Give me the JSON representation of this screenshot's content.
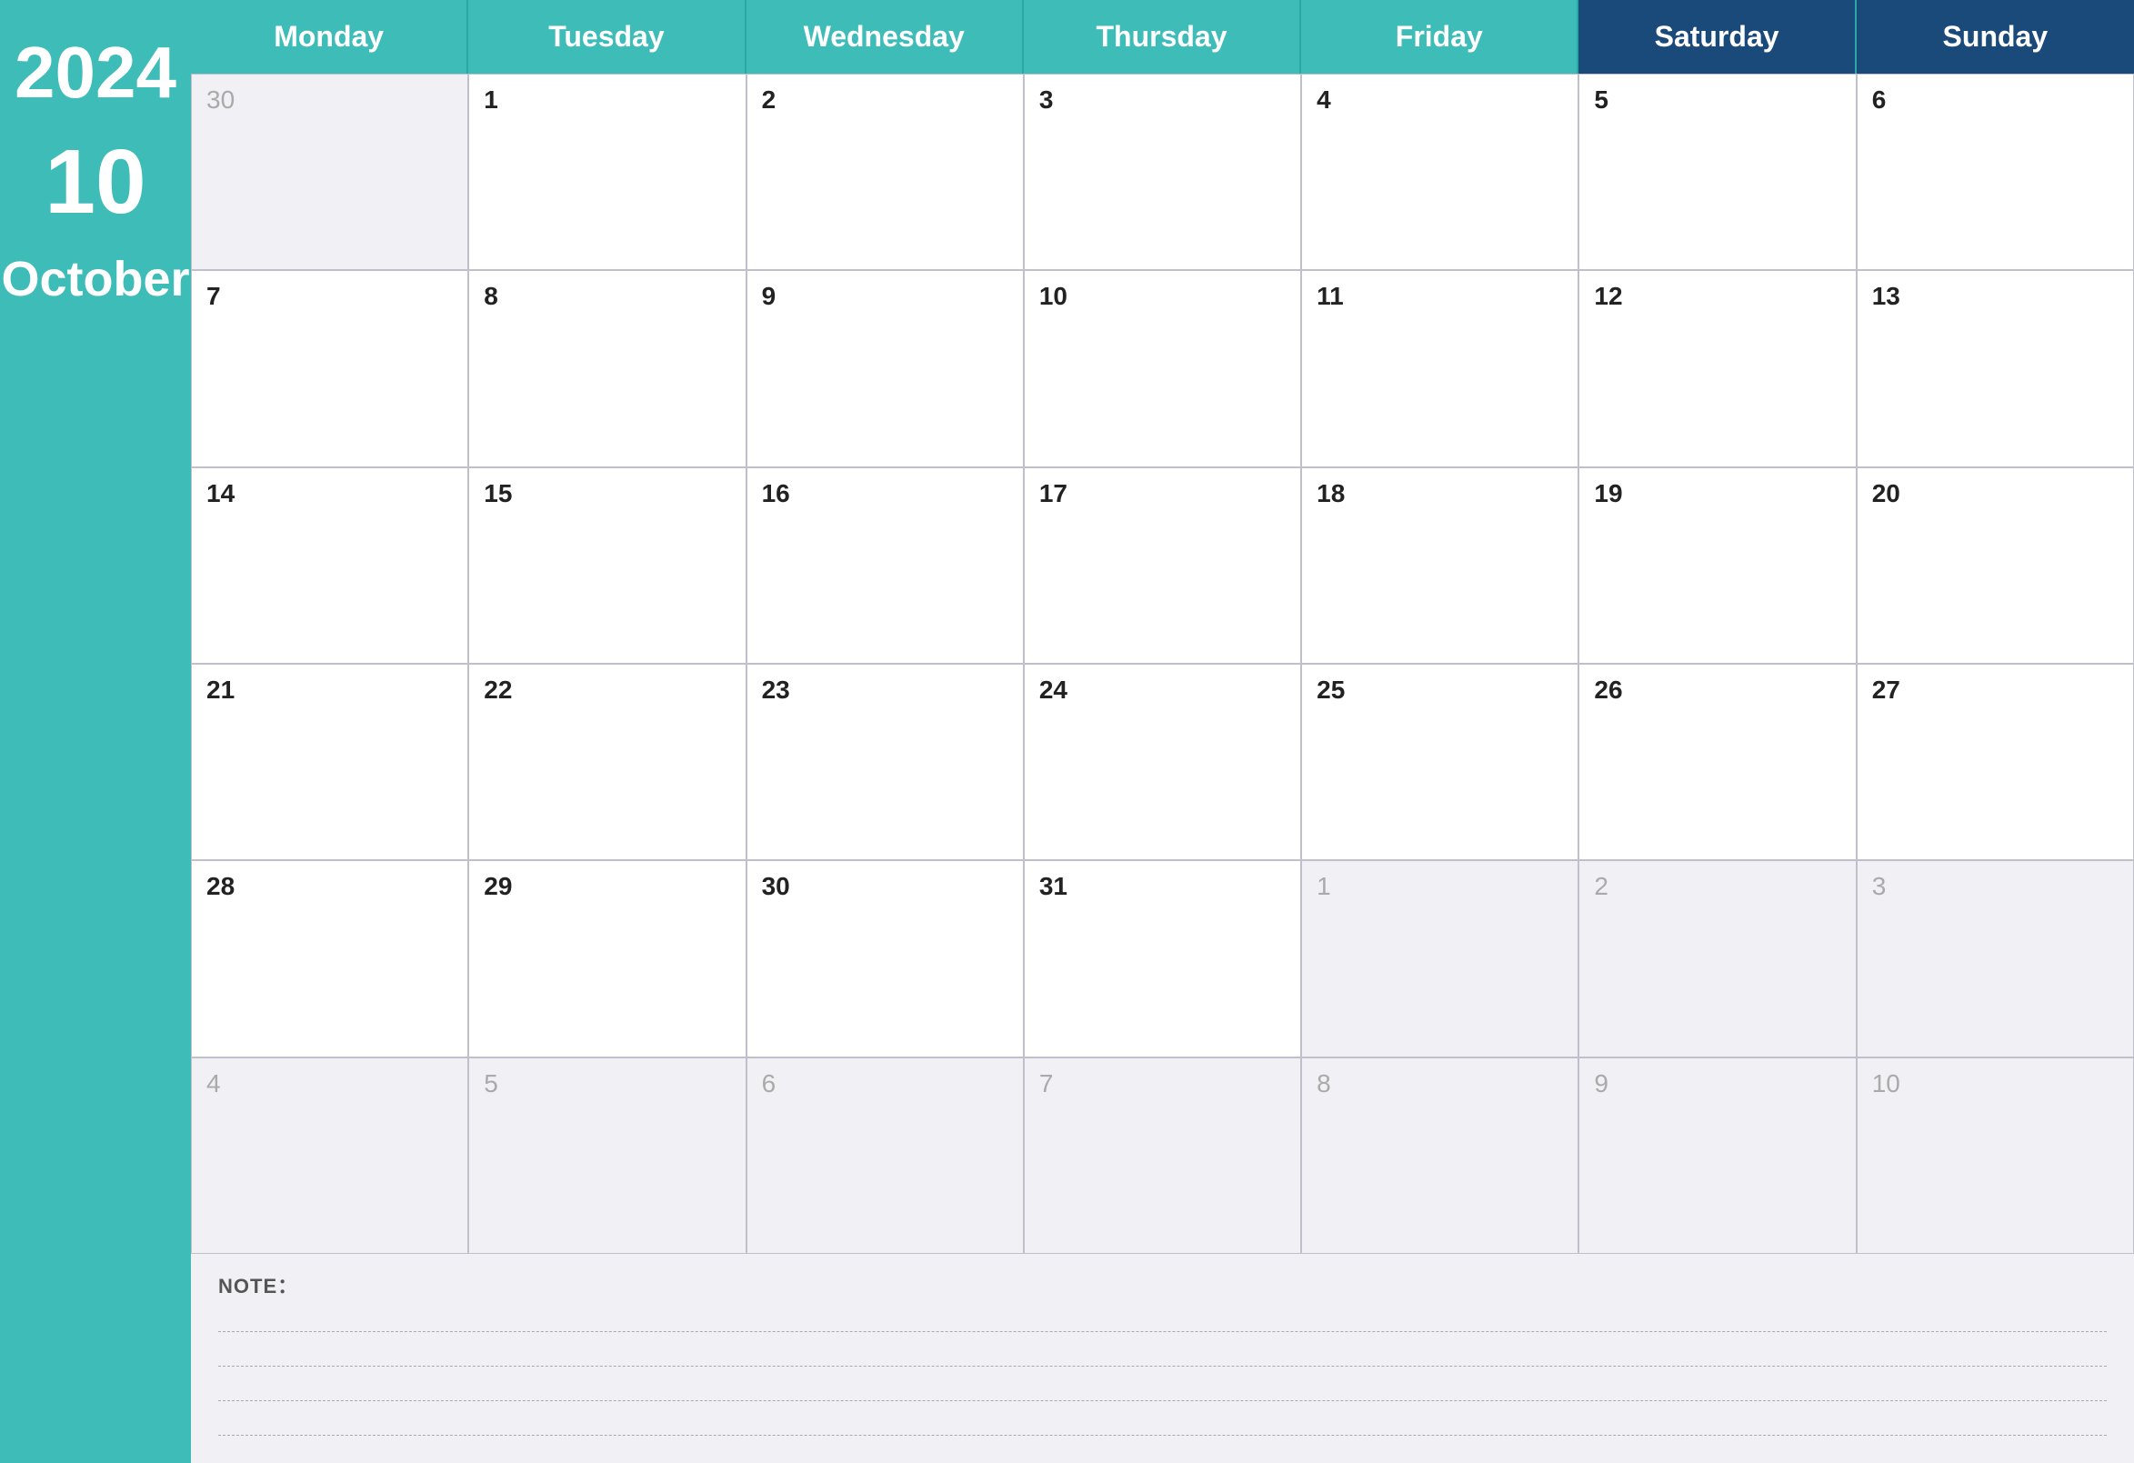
{
  "sidebar": {
    "year": "2024",
    "month_num": "10",
    "month_name": "October"
  },
  "header": {
    "days": [
      {
        "label": "Monday",
        "type": "weekday"
      },
      {
        "label": "Tuesday",
        "type": "weekday"
      },
      {
        "label": "Wednesday",
        "type": "weekday"
      },
      {
        "label": "Thursday",
        "type": "weekday"
      },
      {
        "label": "Friday",
        "type": "weekday"
      },
      {
        "label": "Saturday",
        "type": "weekend"
      },
      {
        "label": "Sunday",
        "type": "weekend"
      }
    ]
  },
  "weeks": [
    [
      {
        "day": "30",
        "outside": true
      },
      {
        "day": "1",
        "outside": false
      },
      {
        "day": "2",
        "outside": false
      },
      {
        "day": "3",
        "outside": false
      },
      {
        "day": "4",
        "outside": false
      },
      {
        "day": "5",
        "outside": false
      },
      {
        "day": "6",
        "outside": false
      }
    ],
    [
      {
        "day": "7",
        "outside": false
      },
      {
        "day": "8",
        "outside": false
      },
      {
        "day": "9",
        "outside": false
      },
      {
        "day": "10",
        "outside": false
      },
      {
        "day": "11",
        "outside": false
      },
      {
        "day": "12",
        "outside": false
      },
      {
        "day": "13",
        "outside": false
      }
    ],
    [
      {
        "day": "14",
        "outside": false
      },
      {
        "day": "15",
        "outside": false
      },
      {
        "day": "16",
        "outside": false
      },
      {
        "day": "17",
        "outside": false
      },
      {
        "day": "18",
        "outside": false
      },
      {
        "day": "19",
        "outside": false
      },
      {
        "day": "20",
        "outside": false
      }
    ],
    [
      {
        "day": "21",
        "outside": false
      },
      {
        "day": "22",
        "outside": false
      },
      {
        "day": "23",
        "outside": false
      },
      {
        "day": "24",
        "outside": false
      },
      {
        "day": "25",
        "outside": false
      },
      {
        "day": "26",
        "outside": false
      },
      {
        "day": "27",
        "outside": false
      }
    ],
    [
      {
        "day": "28",
        "outside": false
      },
      {
        "day": "29",
        "outside": false
      },
      {
        "day": "30",
        "outside": false
      },
      {
        "day": "31",
        "outside": false
      },
      {
        "day": "1",
        "outside": true
      },
      {
        "day": "2",
        "outside": true
      },
      {
        "day": "3",
        "outside": true
      }
    ],
    [
      {
        "day": "4",
        "outside": true
      },
      {
        "day": "5",
        "outside": true
      },
      {
        "day": "6",
        "outside": true
      },
      {
        "day": "7",
        "outside": true
      },
      {
        "day": "8",
        "outside": true
      },
      {
        "day": "9",
        "outside": true
      },
      {
        "day": "10",
        "outside": true
      }
    ]
  ],
  "notes": {
    "label": "NOTE：",
    "lines": 4
  },
  "colors": {
    "teal": "#3dbcb8",
    "navy": "#1a4a7a",
    "outside_bg": "#f0f0f5"
  }
}
